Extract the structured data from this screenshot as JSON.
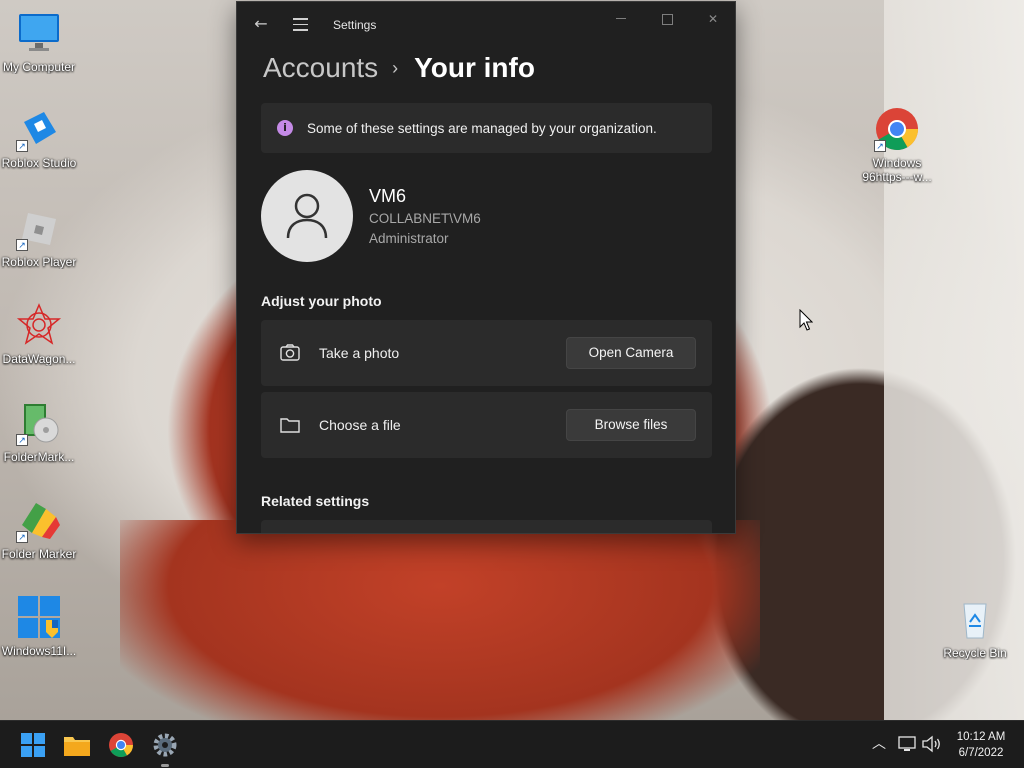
{
  "desktop": {
    "icons": [
      {
        "label": "My Computer"
      },
      {
        "label": "Roblox Studio"
      },
      {
        "label": "Roblox Player"
      },
      {
        "label": "DataWagon..."
      },
      {
        "label": "FolderMark..."
      },
      {
        "label": "Folder Marker"
      },
      {
        "label": "Windows11I..."
      },
      {
        "label_line1": "Windows",
        "label_line2": "96https---w..."
      },
      {
        "label": "Recycle Bin"
      }
    ]
  },
  "window": {
    "title": "Settings",
    "breadcrumb": {
      "parent": "Accounts",
      "separator": "›",
      "current": "Your info"
    },
    "banner": {
      "text": "Some of these settings are managed by your organization.",
      "icon": "info-icon"
    },
    "profile": {
      "name": "VM6",
      "domain": "COLLABNET\\VM6",
      "role": "Administrator"
    },
    "adjust_photo": {
      "title": "Adjust your photo",
      "options": [
        {
          "icon": "camera-icon",
          "label": "Take a photo",
          "button": "Open Camera"
        },
        {
          "icon": "folder-icon",
          "label": "Choose a file",
          "button": "Browse files"
        }
      ]
    },
    "related_settings": {
      "title": "Related settings"
    }
  },
  "taskbar": {
    "clock": {
      "time": "10:12 AM",
      "date": "6/7/2022"
    },
    "apps": [
      "start-icon",
      "file-explorer-icon",
      "chrome-icon",
      "settings-gear-icon"
    ]
  },
  "colors": {
    "window_bg": "#202020",
    "card_bg": "#2b2b2b",
    "info_accent": "#c48ae6",
    "taskbar_bg": "#1c1c1c"
  }
}
